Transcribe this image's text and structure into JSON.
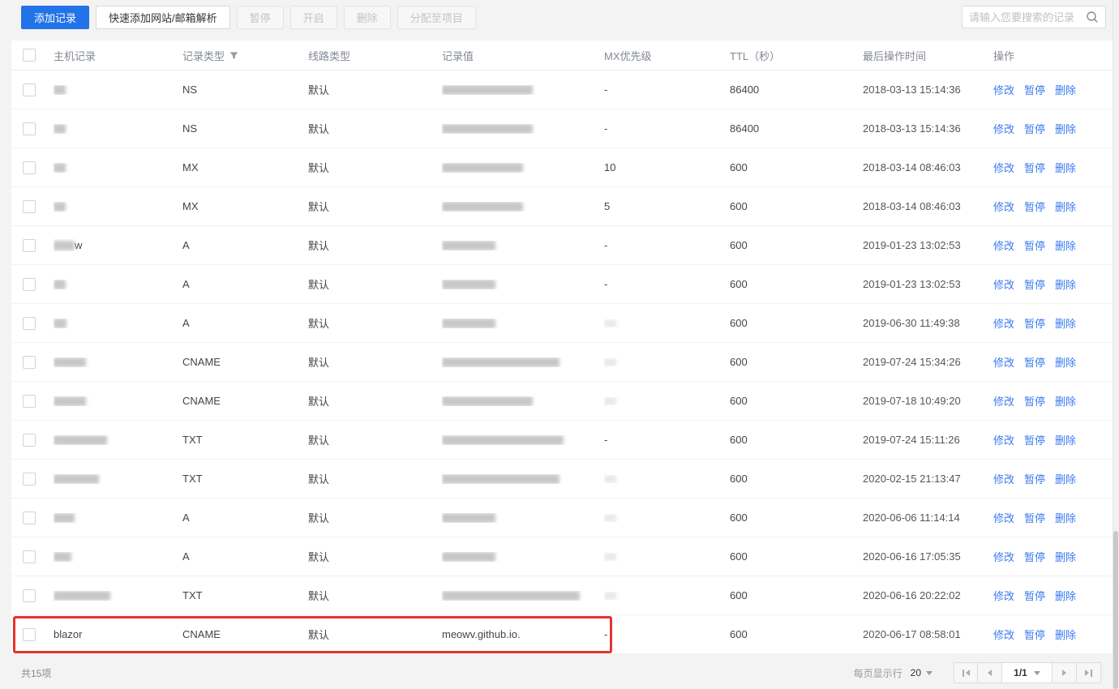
{
  "toolbar": {
    "add_record": "添加记录",
    "quick_add": "快速添加网站/邮箱解析",
    "pause": "暂停",
    "enable": "开启",
    "delete": "删除",
    "assign_to_project": "分配至项目",
    "search_placeholder": "请输入您要搜索的记录"
  },
  "table": {
    "headers": [
      "主机记录",
      "记录类型",
      "线路类型",
      "记录值",
      "MX优先级",
      "TTL（秒）",
      "最后操作时间",
      "操作"
    ],
    "actions": [
      "修改",
      "暂停",
      "删除"
    ],
    "rows": [
      {
        "host_blur": 15,
        "type": "NS",
        "line": "默认",
        "value_blur": 112,
        "mx": "-",
        "ttl": "86400",
        "time": "2018-03-13 15:14:36"
      },
      {
        "host_blur": 15,
        "type": "NS",
        "line": "默认",
        "value_blur": 112,
        "mx": "-",
        "ttl": "86400",
        "time": "2018-03-13 15:14:36"
      },
      {
        "host_blur": 15,
        "type": "MX",
        "line": "默认",
        "value_blur": 100,
        "mx": "10",
        "ttl": "600",
        "time": "2018-03-14 08:46:03"
      },
      {
        "host_blur": 15,
        "type": "MX",
        "line": "默认",
        "value_blur": 100,
        "mx": "5",
        "ttl": "600",
        "time": "2018-03-14 08:46:03"
      },
      {
        "host_blur": 26,
        "host_text": "w",
        "type": "A",
        "line": "默认",
        "value_blur": 66,
        "mx": "-",
        "ttl": "600",
        "time": "2019-01-23 13:02:53"
      },
      {
        "host_blur": 15,
        "type": "A",
        "line": "默认",
        "value_blur": 66,
        "mx": "-",
        "ttl": "600",
        "time": "2019-01-23 13:02:53"
      },
      {
        "host_blur": 16,
        "type": "A",
        "line": "默认",
        "value_blur": 66,
        "mx_blur": true,
        "ttl": "600",
        "time": "2019-06-30 11:49:38"
      },
      {
        "host_blur": 40,
        "type": "CNAME",
        "line": "默认",
        "value_blur": 145,
        "mx_blur": true,
        "ttl": "600",
        "time": "2019-07-24 15:34:26"
      },
      {
        "host_blur": 40,
        "type": "CNAME",
        "line": "默认",
        "value_blur": 112,
        "mx_blur": true,
        "ttl": "600",
        "time": "2019-07-18 10:49:20"
      },
      {
        "host_blur": 66,
        "type": "TXT",
        "line": "默认",
        "value_blur": 150,
        "mx": "-",
        "ttl": "600",
        "time": "2019-07-24 15:11:26"
      },
      {
        "host_blur": 56,
        "type": "TXT",
        "line": "默认",
        "value_blur": 145,
        "mx_blur": true,
        "ttl": "600",
        "time": "2020-02-15 21:13:47"
      },
      {
        "host_blur": 26,
        "type": "A",
        "line": "默认",
        "value_blur": 66,
        "mx_blur": true,
        "ttl": "600",
        "time": "2020-06-06 11:14:14"
      },
      {
        "host_blur": 22,
        "type": "A",
        "line": "默认",
        "value_blur": 66,
        "mx_blur": true,
        "ttl": "600",
        "time": "2020-06-16 17:05:35"
      },
      {
        "host_blur": 70,
        "type": "TXT",
        "line": "默认",
        "value_blur": 170,
        "mx_blur": true,
        "ttl": "600",
        "time": "2020-06-16 20:22:02"
      },
      {
        "host_text": "blazor",
        "type": "CNAME",
        "line": "默认",
        "value_text": "meowv.github.io.",
        "mx": "-",
        "ttl": "600",
        "time": "2020-06-17 08:58:01",
        "highlighted": true
      }
    ]
  },
  "footer": {
    "total": "共15项",
    "per_page_label": "每页显示行",
    "per_page_value": "20",
    "page_indicator": "1/1"
  },
  "icons": {
    "filter": "funnel",
    "search": "magnifier"
  },
  "colors": {
    "primary_blue": "#2373e8",
    "link_blue": "#3a7af0",
    "highlight_red": "#e5342e",
    "page_background": "#f3f3f3"
  }
}
